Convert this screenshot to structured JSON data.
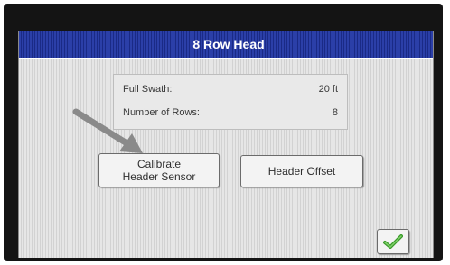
{
  "window": {
    "title": "8 Row Head"
  },
  "info": {
    "rows": [
      {
        "label": "Full Swath:",
        "value": "20 ft"
      },
      {
        "label": "Number of Rows:",
        "value": "8"
      }
    ]
  },
  "buttons": {
    "calibrate_line1": "Calibrate",
    "calibrate_line2": "Header Sensor",
    "header_offset": "Header Offset"
  },
  "icons": {
    "ok": "checkmark-icon",
    "pointer": "arrow-icon"
  },
  "colors": {
    "titlebar": "#2b3fa8",
    "checkmark": "#3a9a2a",
    "arrow": "#8a8a8a"
  }
}
